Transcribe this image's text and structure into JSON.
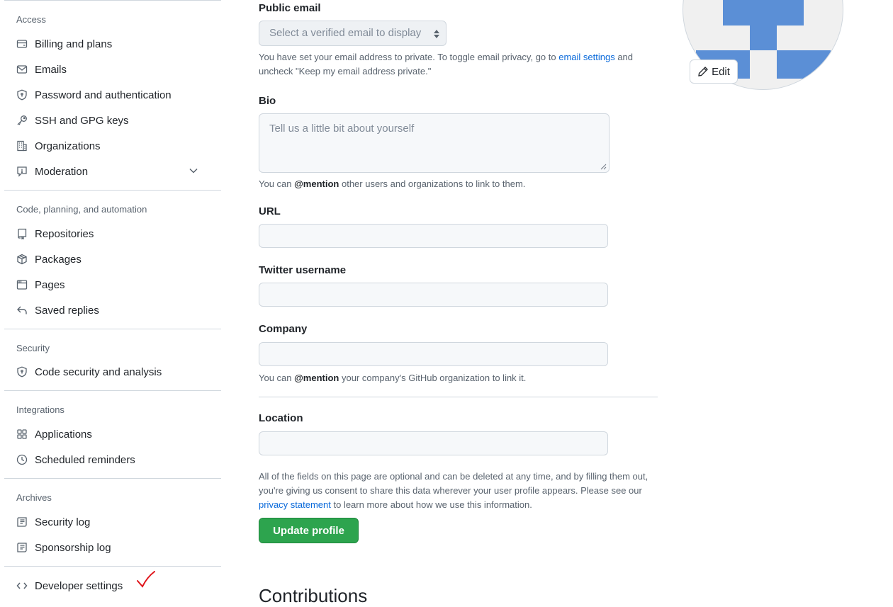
{
  "sidebar": {
    "sections": [
      {
        "heading": "Access",
        "items": [
          {
            "label": "Billing and plans",
            "icon": "credit-card-icon"
          },
          {
            "label": "Emails",
            "icon": "mail-icon"
          },
          {
            "label": "Password and authentication",
            "icon": "shield-lock-icon"
          },
          {
            "label": "SSH and GPG keys",
            "icon": "key-icon"
          },
          {
            "label": "Organizations",
            "icon": "organization-icon"
          },
          {
            "label": "Moderation",
            "icon": "report-icon"
          }
        ]
      },
      {
        "heading": "Code, planning, and automation",
        "items": [
          {
            "label": "Repositories",
            "icon": "repo-icon"
          },
          {
            "label": "Packages",
            "icon": "package-icon"
          },
          {
            "label": "Pages",
            "icon": "browser-icon"
          },
          {
            "label": "Saved replies",
            "icon": "reply-icon"
          }
        ]
      },
      {
        "heading": "Security",
        "items": [
          {
            "label": "Code security and analysis",
            "icon": "shield-lock-icon"
          }
        ]
      },
      {
        "heading": "Integrations",
        "items": [
          {
            "label": "Applications",
            "icon": "apps-icon"
          },
          {
            "label": "Scheduled reminders",
            "icon": "clock-icon"
          }
        ]
      },
      {
        "heading": "Archives",
        "items": [
          {
            "label": "Security log",
            "icon": "log-icon"
          },
          {
            "label": "Sponsorship log",
            "icon": "log-icon"
          }
        ]
      }
    ],
    "developer_settings": {
      "label": "Developer settings",
      "icon": "code-icon"
    }
  },
  "form": {
    "public_email": {
      "label": "Public email",
      "placeholder": "Select a verified email to display",
      "note_before": "You have set your email address to private. To toggle email privacy, go to ",
      "note_link": "email settings",
      "note_after": " and uncheck \"Keep my email address private.\""
    },
    "bio": {
      "label": "Bio",
      "placeholder": "Tell us a little bit about yourself",
      "note_before": "You can ",
      "note_bold": "@mention",
      "note_after": " other users and organizations to link to them."
    },
    "url": {
      "label": "URL",
      "value": ""
    },
    "twitter": {
      "label": "Twitter username",
      "value": ""
    },
    "company": {
      "label": "Company",
      "value": "",
      "note_before": "You can ",
      "note_bold": "@mention",
      "note_after": " your company's GitHub organization to link it."
    },
    "location": {
      "label": "Location",
      "value": ""
    },
    "disclaimer_before": "All of the fields on this page are optional and can be deleted at any time, and by filling them out, you're giving us consent to share this data wherever your user profile appears. Please see our ",
    "disclaimer_link": "privacy statement",
    "disclaimer_after": " to learn more about how we use this information.",
    "submit_label": "Update profile",
    "next_heading": "Contributions"
  },
  "avatar": {
    "edit_label": "Edit",
    "color": "#5b8fd6"
  }
}
